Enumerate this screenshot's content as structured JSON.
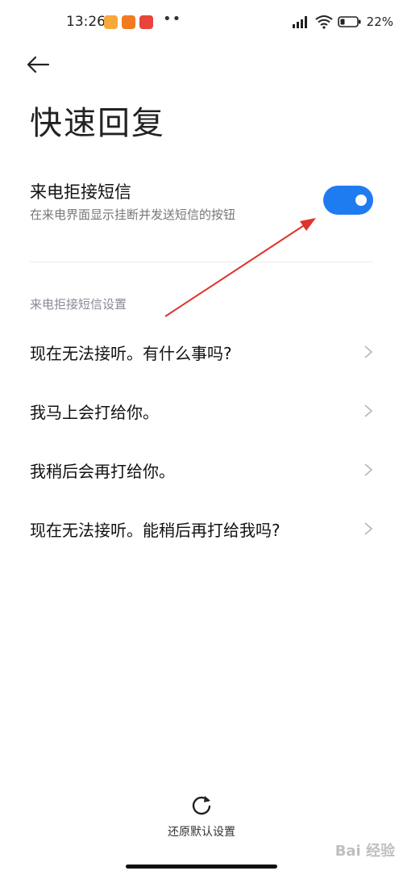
{
  "status_bar": {
    "time": "13:26",
    "dots": "••",
    "battery": "22%"
  },
  "page": {
    "title": "快速回复"
  },
  "setting": {
    "title": "来电拒接短信",
    "description": "在来电界面显示挂断并发送短信的按钮",
    "enabled": true,
    "accent_color": "#1f7cf0"
  },
  "section": {
    "header": "来电拒接短信设置"
  },
  "replies": [
    {
      "label": "现在无法接听。有什么事吗?"
    },
    {
      "label": "我马上会打给你。"
    },
    {
      "label": "我稍后会再打给你。"
    },
    {
      "label": "现在无法接听。能稍后再打给我吗?"
    }
  ],
  "footer": {
    "reset_label": "还原默认设置"
  },
  "watermark": {
    "text": "Bai 经验"
  }
}
